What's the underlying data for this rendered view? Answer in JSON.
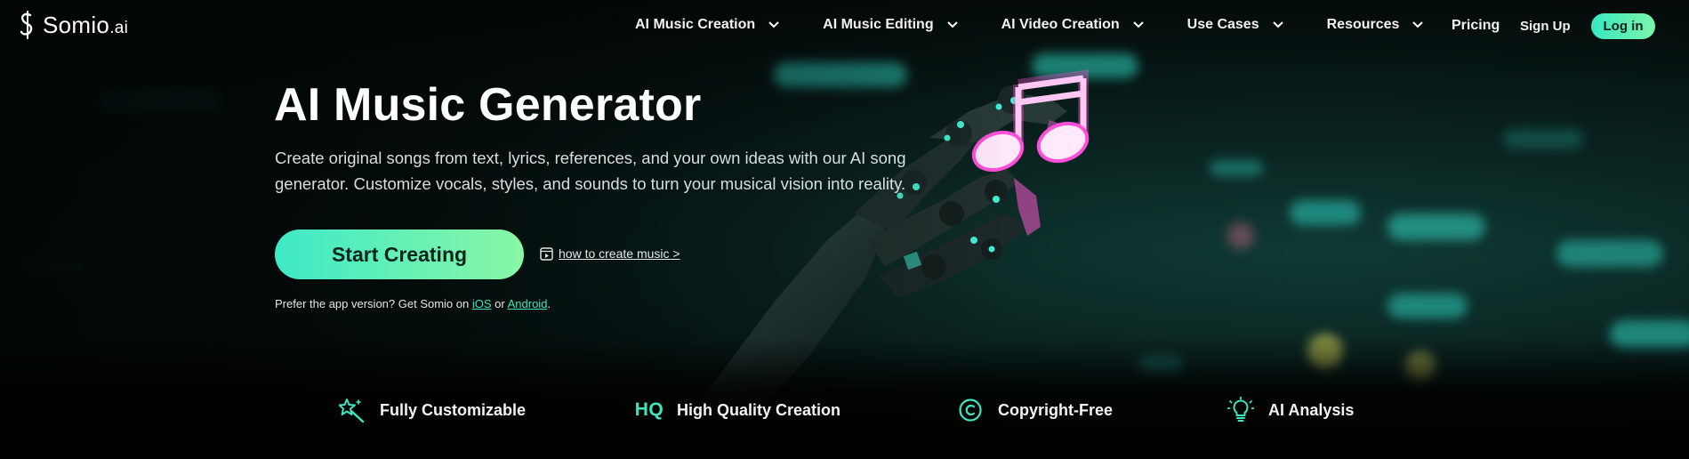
{
  "brand": {
    "name": "Somio",
    "suffix": ".ai"
  },
  "nav": {
    "menu": [
      {
        "label": "AI Music Creation"
      },
      {
        "label": "AI Music Editing"
      },
      {
        "label": "AI Video Creation"
      },
      {
        "label": "Use Cases"
      },
      {
        "label": "Resources"
      }
    ],
    "pricing": "Pricing",
    "signup": "Sign Up",
    "login": "Log in"
  },
  "hero": {
    "title": "AI Music Generator",
    "description": "Create original songs from text, lyrics, references, and your own ideas with our AI song generator. Customize vocals, styles, and sounds to turn your musical vision into reality.",
    "cta": "Start Creating",
    "how_to": "how to create music >",
    "app_note_prefix": "Prefer the app version? Get Somio on ",
    "ios": "iOS",
    "or": " or ",
    "android": "Android",
    "app_note_suffix": "."
  },
  "features": [
    {
      "icon": "magic-wand-icon",
      "label": "Fully Customizable"
    },
    {
      "icon": "hq-badge-icon",
      "badge": "HQ",
      "label": "High Quality Creation"
    },
    {
      "icon": "copyright-icon",
      "label": "Copyright-Free"
    },
    {
      "icon": "lightbulb-icon",
      "label": "AI Analysis"
    }
  ],
  "colors": {
    "accent": "#3EE9C6",
    "accent_end": "#8AF7A6",
    "neon_pink": "#FF4FD8",
    "background": "#040707"
  }
}
